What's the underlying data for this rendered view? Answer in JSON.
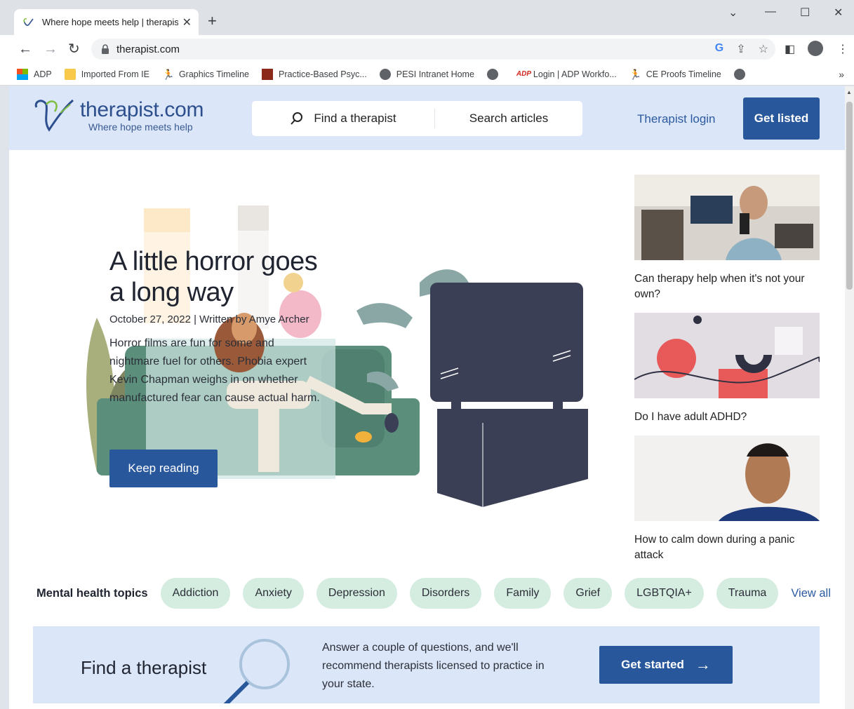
{
  "browser": {
    "tab_title": "Where hope meets help | therapist",
    "url": "therapist.com",
    "bookmarks": [
      {
        "label": "ADP",
        "icon": "microsoft-icon"
      },
      {
        "label": "Imported From IE",
        "icon": "folder-icon"
      },
      {
        "label": "Graphics Timeline",
        "icon": "runner-icon"
      },
      {
        "label": "Practice-Based Psyc...",
        "icon": "book-icon"
      },
      {
        "label": "PESI Intranet Home",
        "icon": "globe-icon"
      },
      {
        "label": "",
        "icon": "globe-icon"
      },
      {
        "label": "Login | ADP Workfo...",
        "icon": "adp-icon"
      },
      {
        "label": "CE Proofs Timeline",
        "icon": "runner-icon"
      },
      {
        "label": "",
        "icon": "globe-icon"
      }
    ],
    "more_bookmarks": "»"
  },
  "header": {
    "logo_name": "therapist.com",
    "logo_tagline": "Where hope meets help",
    "find_therapist": "Find a therapist",
    "search_articles": "Search articles",
    "therapist_login": "Therapist login",
    "get_listed": "Get listed"
  },
  "hero": {
    "title": "A little horror goes a long way",
    "meta": "October 27, 2022 | Written by Amye Archer",
    "description": "Horror films are fun for some and nightmare fuel for others. Phobia expert Kevin Chapman weighs in on whether manufactured fear can cause actual harm.",
    "button": "Keep reading"
  },
  "side_articles": [
    {
      "caption": "Can therapy help when it's not your own?"
    },
    {
      "caption": "Do I have adult ADHD?"
    },
    {
      "caption": "How to calm down during a panic attack"
    }
  ],
  "topics": {
    "label": "Mental health topics",
    "items": [
      "Addiction",
      "Anxiety",
      "Depression",
      "Disorders",
      "Family",
      "Grief",
      "LGBTQIA+",
      "Trauma"
    ],
    "view_all": "View all"
  },
  "find_banner": {
    "title": "Find a therapist",
    "text": "Answer a couple of questions, and we'll recommend therapists licensed to practice in your state.",
    "button": "Get started"
  },
  "colors": {
    "brand_blue": "#28579c",
    "header_bg": "#dbe6f8",
    "pill_bg": "#d5ece0",
    "link_blue": "#2c5aa0"
  }
}
